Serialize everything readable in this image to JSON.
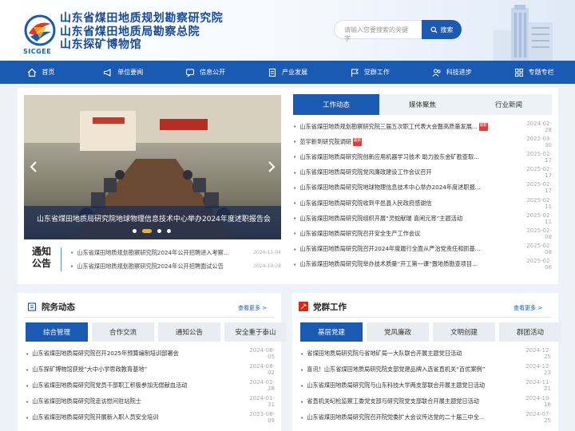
{
  "header": {
    "logo_text": "SICGEE",
    "title_lines": [
      "山东省煤田地质规划勘察研究院",
      "山东省煤田地质局勘察总院",
      "山东探矿博物馆"
    ],
    "search_placeholder": "请输入您要搜索的关键字",
    "search_button": "搜索"
  },
  "nav": [
    {
      "label": "首页",
      "icon": "home-icon"
    },
    {
      "label": "单位要闻",
      "icon": "megaphone-icon"
    },
    {
      "label": "信息公开",
      "icon": "chat-icon"
    },
    {
      "label": "产业发展",
      "icon": "document-icon"
    },
    {
      "label": "党群工作",
      "icon": "flag-icon"
    },
    {
      "label": "科技进步",
      "icon": "users-icon"
    },
    {
      "label": "专题专栏",
      "icon": "grid-icon"
    }
  ],
  "carousel": {
    "caption": "山东省煤田地质局研究院地球物理信息技术中心举办2024年度述职报告会",
    "slide_count": 4,
    "active_index": 1
  },
  "notice": {
    "label_line1": "通知",
    "label_line2": "公告",
    "items": [
      {
        "title": "山东省煤田地质规划勘察研究院2024年公开招聘进入考察...",
        "date": "2024-11-04"
      },
      {
        "title": "山东省煤田地质规划勘察研究院2024年公开招聘面试公告",
        "date": "2024-10-28"
      }
    ]
  },
  "news_tabs": [
    "工作动态",
    "媒体聚焦",
    "行业新闻"
  ],
  "news": [
    {
      "title": "山东省煤田地质规划勘察研究院三届五次职工代表大会暨高质量发展...",
      "hot": "最新",
      "date": "2024-02-28"
    },
    {
      "title": "范宇新到研究院调研",
      "hot": "最新",
      "date": "2022-03-30"
    },
    {
      "title": "山东省煤田地质局研究院创新应用机器学习技术 助力胶东金矿勘查取...",
      "date": "2025-02-17"
    },
    {
      "title": "山东省煤田地质局研究院党风廉政建设工作会议召开",
      "date": "2025-02-17"
    },
    {
      "title": "山东省煤田地质局研究院地球物理信息技术中心举办2024年度述职报...",
      "date": "2025-02-17"
    },
    {
      "title": "山东省煤田地质局研究院收到平邑县人民政府感谢信",
      "date": "2025-02-11"
    },
    {
      "title": "山东省煤田地质局研究院组织开展“灵蛇献瑞 喜闹元宵”主题活动",
      "date": "2025-02-11"
    },
    {
      "title": "山东省煤田地质局研究院召开安全生产工作会议",
      "date": "2025-02-08"
    },
    {
      "title": "山东省煤田地质局研究院召开2024年度履行全面从严治党责任和抓基...",
      "date": "2025-02-08"
    },
    {
      "title": "山东省煤田地质局研究院举办技术质量“开工第一课”暨地质勘查项目...",
      "date": "2025-02-06"
    }
  ],
  "affairs": {
    "title": "院务动态",
    "more": "查看更多 >",
    "tabs": [
      "综合管理",
      "合作交流",
      "通知公告",
      "安全重于泰山"
    ],
    "items": [
      {
        "title": "山东省煤田地质局研究院召开2025年预算编制培训部署会",
        "date": "2024-08-05"
      },
      {
        "title": "山东探矿博物馆获授“大中小学思政教育基地”",
        "date": "2024-08-02"
      },
      {
        "title": "山东省煤田地质局研究院党员干部职工积极参加无偿献血活动",
        "date": "2024-02-28"
      },
      {
        "title": "山东省煤田地质局研究院走访慰问驻站院士",
        "date": "2024-01-31"
      },
      {
        "title": "山东省煤田地质局研究院开展新入职人员安全培训",
        "date": "2023-08-09"
      }
    ]
  },
  "party": {
    "title": "党群工作",
    "more": "查看更多 >",
    "tabs": [
      "基层党建",
      "党风廉政",
      "文明创建",
      "群团活动"
    ],
    "items": [
      {
        "title": "省煤田地质局研究院与省地矿局一大队联合开展主题党日活动",
        "date": "2024-12-25"
      },
      {
        "title": "喜讯！山东省煤田地质局研究院支部党建品牌入选省直机关“百优案例”",
        "date": "2024-12-23"
      },
      {
        "title": "山东省煤田地质局研究院与山东科技大学两支部联合开展主题党日活动",
        "date": "2024-11-21"
      },
      {
        "title": "省直机关纪检监察工委党支部与研究院党支部联合开展主题党日活动",
        "date": "2024-10-16"
      },
      {
        "title": "山东省煤田地质局研究院召开院党委扩大会议传达党的二十届三中全...",
        "date": "2024-07-25"
      }
    ]
  },
  "colors": {
    "primary": "#1a5ab3",
    "accent": "#f0b21c",
    "hot": "#e23b3b"
  }
}
